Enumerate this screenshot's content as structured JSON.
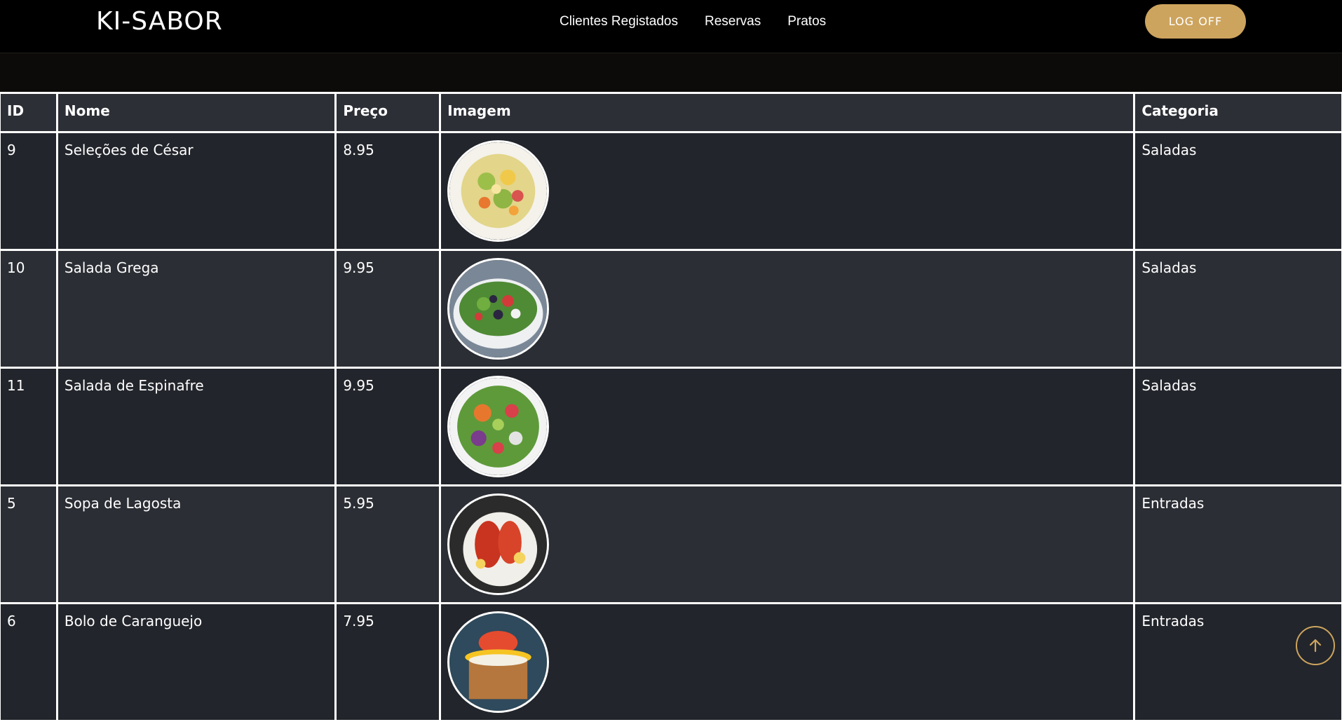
{
  "header": {
    "logo": "KI-SABOR",
    "nav": [
      "Clientes Registados",
      "Reservas",
      "Pratos"
    ],
    "logoff_label": "LOG OFF"
  },
  "table": {
    "columns": [
      "ID",
      "Nome",
      "Preço",
      "Imagem",
      "Categoria"
    ],
    "rows": [
      {
        "id": "9",
        "nome": "Seleções de César",
        "preco": "8.95",
        "image": "caesar-salad",
        "categoria": "Saladas"
      },
      {
        "id": "10",
        "nome": "Salada Grega",
        "preco": "9.95",
        "image": "greek-salad",
        "categoria": "Saladas"
      },
      {
        "id": "11",
        "nome": "Salada de Espinafre",
        "preco": "9.95",
        "image": "spinach-salad",
        "categoria": "Saladas"
      },
      {
        "id": "5",
        "nome": "Sopa de Lagosta",
        "preco": "5.95",
        "image": "lobster-dish",
        "categoria": "Entradas"
      },
      {
        "id": "6",
        "nome": "Bolo de Caranguejo",
        "preco": "7.95",
        "image": "crab-cake",
        "categoria": "Entradas"
      }
    ]
  },
  "colors": {
    "accent": "#cda45e",
    "header_bg": "#000000",
    "row_dark": "#22252b",
    "row_light": "#2b2e34"
  },
  "icons": {
    "back_to_top": "arrow-up-icon"
  }
}
